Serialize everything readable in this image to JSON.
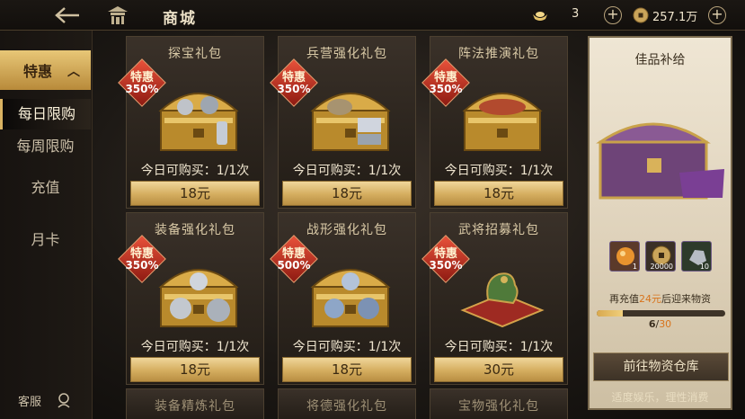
{
  "header": {
    "title": "商城",
    "ingot_value": "3",
    "coin_value": "257.1万"
  },
  "nav": {
    "section_label": "特惠",
    "items": [
      {
        "label": "每日限购"
      },
      {
        "label": "每周限购"
      },
      {
        "label": "充值"
      },
      {
        "label": "月卡"
      }
    ],
    "service_label": "客服"
  },
  "cards": [
    {
      "name": "探宝礼包",
      "badge_label": "特惠",
      "discount": "350%",
      "limit": "今日可购买：1/1次",
      "price": "18元"
    },
    {
      "name": "兵营强化礼包",
      "badge_label": "特惠",
      "discount": "350%",
      "limit": "今日可购买：1/1次",
      "price": "18元"
    },
    {
      "name": "阵法推演礼包",
      "badge_label": "特惠",
      "discount": "350%",
      "limit": "今日可购买：1/1次",
      "price": "18元"
    },
    {
      "name": "装备强化礼包",
      "badge_label": "特惠",
      "discount": "350%",
      "limit": "今日可购买：1/1次",
      "price": "18元"
    },
    {
      "name": "战形强化礼包",
      "badge_label": "特惠",
      "discount": "500%",
      "limit": "今日可购买：1/1次",
      "price": "18元"
    },
    {
      "name": "武将招募礼包",
      "badge_label": "特惠",
      "discount": "350%",
      "limit": "今日可购买：1/1次",
      "price": "30元"
    }
  ],
  "next_row": [
    {
      "name": "装备精炼礼包"
    },
    {
      "name": "将德强化礼包"
    },
    {
      "name": "宝物强化礼包"
    }
  ],
  "reward_panel": {
    "title": "佳品补给",
    "items": [
      {
        "icon": "orb-icon",
        "count": "1"
      },
      {
        "icon": "coin-icon",
        "count": "20000"
      },
      {
        "icon": "silver-ore-icon",
        "count": "10"
      }
    ],
    "hint_prefix": "再充值",
    "hint_amount": "24元",
    "hint_suffix": "后迎来物资",
    "progress_current": "6",
    "progress_sep": "/",
    "progress_total": "30",
    "progress_fraction": 0.2,
    "button_label": "前往物资仓库",
    "footer": "适度娱乐，理性消费"
  }
}
